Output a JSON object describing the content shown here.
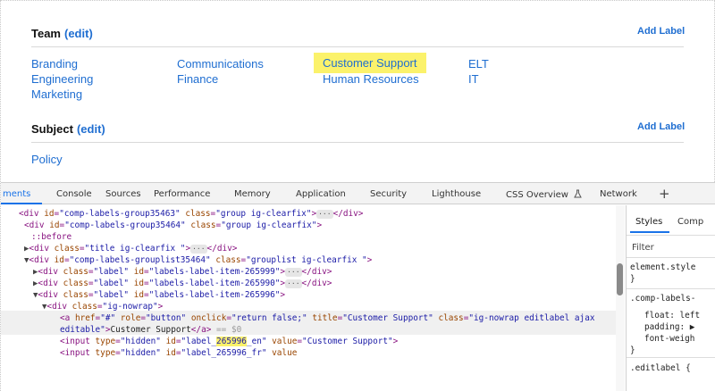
{
  "team": {
    "title": "Team",
    "edit_label": "(edit)",
    "add_label": "Add Label",
    "labels": [
      "Branding",
      "Communications",
      "Customer Support",
      "ELT",
      "Engineering",
      "Finance",
      "Human Resources",
      "IT",
      "Marketing"
    ]
  },
  "subject": {
    "title": "Subject",
    "edit_label": "(edit)",
    "add_label": "Add Label",
    "labels": [
      "Policy"
    ]
  },
  "devtools": {
    "tabs": [
      "ments",
      "Console",
      "Sources",
      "Performance",
      "Memory",
      "Application",
      "Security",
      "Lighthouse",
      "CSS Overview",
      "Network"
    ],
    "active_tab": "ments",
    "more_tabs_glyph": "+",
    "code_lines": {
      "l1_open": "<div",
      "l1_a1": "id",
      "l1_v1": "\"comp-labels-group35463\"",
      "l1_a2": "class",
      "l1_v2": "\"group ig-clearfix\"",
      "l1_close": "</div>",
      "l2_open": "<div",
      "l2_a1": "id",
      "l2_v1": "\"comp-labels-group35464\"",
      "l2_a2": "class",
      "l2_v2": "\"group ig-clearfix\"",
      "l3_pseudo": "::before",
      "l4_open": "<div",
      "l4_a1": "class",
      "l4_v1": "\"title ig-clearfix \"",
      "l4_close": "</div>",
      "l5_open": "<div",
      "l5_a1": "id",
      "l5_v1": "\"comp-labels-grouplist35464\"",
      "l5_a2": "class",
      "l5_v2": "\"grouplist ig-clearfix \"",
      "l6_open": "<div",
      "l6_a1": "class",
      "l6_v1": "\"label\"",
      "l6_a2": "id",
      "l6_v2": "\"labels-label-item-265999\"",
      "l6_close": "</div>",
      "l7_open": "<div",
      "l7_a1": "class",
      "l7_v1": "\"label\"",
      "l7_a2": "id",
      "l7_v2": "\"labels-label-item-265990\"",
      "l7_close": "</div>",
      "l8_open": "<div",
      "l8_a1": "class",
      "l8_v1": "\"label\"",
      "l8_a2": "id",
      "l8_v2": "\"labels-label-item-265996\"",
      "l9_open": "<div",
      "l9_a1": "class",
      "l9_v1": "\"ig-nowrap\"",
      "l10_open": "<a",
      "l10_a1": "href",
      "l10_v1": "\"#\"",
      "l10_a2": "role",
      "l10_v2": "\"button\"",
      "l10_a3": "onclick",
      "l10_v3": "\"return false;\"",
      "l10_a4": "title",
      "l10_v4": "\"Customer Support\"",
      "l10_a5": "class",
      "l10_v5": "\"ig-nowrap editlabel ajax",
      "l11_v": "editable\"",
      "l11_text": "Customer Support",
      "l11_close": "</a>",
      "l11_eq": "== $0",
      "l12_open": "<input",
      "l12_a1": "type",
      "l12_v1": "\"hidden\"",
      "l12_a2": "id",
      "l12_v2a": "\"label_",
      "l12_v2hl": "265996",
      "l12_v2b": "_en\"",
      "l12_a3": "value",
      "l12_v3": "\"Customer Support\"",
      "l13_open": "<input",
      "l13_a1": "type",
      "l13_v1": "\"hidden\"",
      "l13_a2": "id",
      "l13_v2": "\"label_265996_fr\"",
      "l13_a3": "value"
    },
    "styles_panel": {
      "tab_styles": "Styles",
      "tab_computed": "Comp",
      "filter_placeholder": "Filter",
      "rule1_selector": "element.style",
      "rule1_close": "}",
      "rule2_selector": ".comp-labels-",
      "rule2_p1": "float: left",
      "rule2_p2": "padding: ▶",
      "rule2_p3": "font-weigh",
      "rule2_close": "}",
      "rule3_selector": ".editlabel {"
    }
  }
}
